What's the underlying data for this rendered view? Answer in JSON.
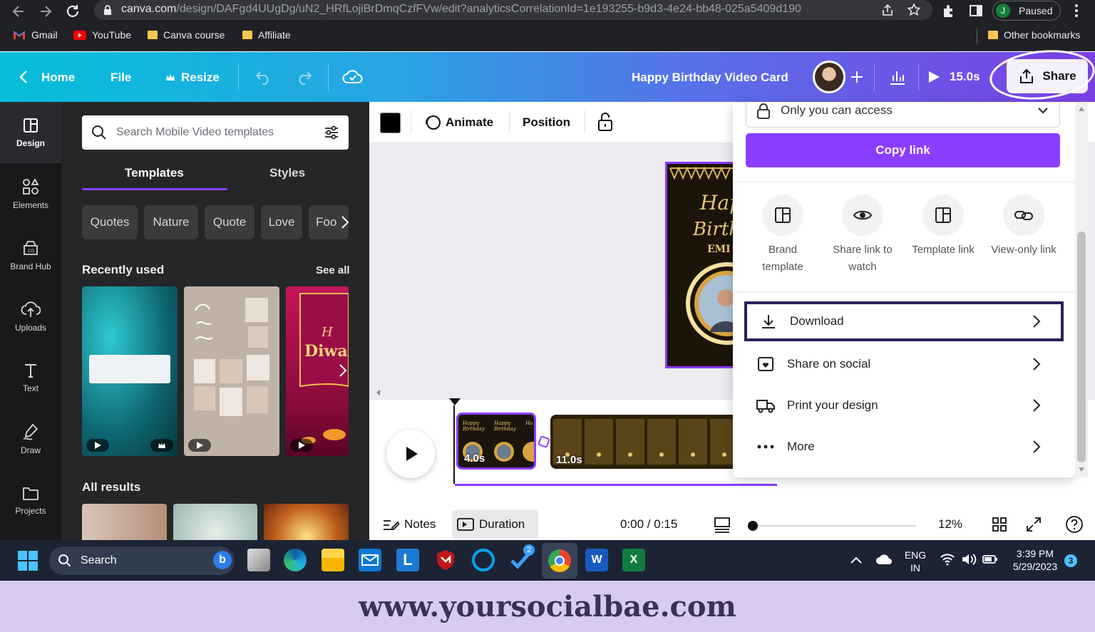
{
  "browser": {
    "url_host": "canva.com",
    "url_path": "/design/DAFgd4UUgDg/uN2_HRfLojiBrDmqCzfFVw/edit?analyticsCorrelationId=1e193255-b9d3-4e24-bb48-025a5409d190",
    "profile_initial": "J",
    "profile_status": "Paused",
    "bookmarks": [
      "Gmail",
      "YouTube",
      "Canva course",
      "Affiliate"
    ],
    "other_bookmarks": "Other bookmarks"
  },
  "header": {
    "home": "Home",
    "file": "File",
    "resize": "Resize",
    "title": "Happy Birthday Video Card",
    "duration": "15.0s",
    "share": "Share"
  },
  "rail": [
    "Design",
    "Elements",
    "Brand Hub",
    "Uploads",
    "Text",
    "Draw",
    "Projects"
  ],
  "panel": {
    "search_placeholder": "Search Mobile Video templates",
    "tabs": [
      "Templates",
      "Styles"
    ],
    "chips": [
      "Quotes",
      "Nature",
      "Quote",
      "Love",
      "Foo"
    ],
    "recent_title": "Recently used",
    "see_all": "See all",
    "all_results": "All results"
  },
  "toolbar": {
    "animate": "Animate",
    "position": "Position"
  },
  "timeline": {
    "clip1": "4.0s",
    "clip2": "11.0s",
    "notes": "Notes",
    "duration": "Duration",
    "time": "0:00 / 0:15",
    "zoom": "12%"
  },
  "share_menu": {
    "access": "Only you can access",
    "copy_link": "Copy link",
    "options": [
      {
        "line1": "Brand",
        "line2": "template"
      },
      {
        "line1": "Share link to",
        "line2": "watch"
      },
      {
        "line1": "Template link",
        "line2": ""
      },
      {
        "line1": "View-only link",
        "line2": ""
      }
    ],
    "rows": [
      "Download",
      "Share on social",
      "Print your design",
      "More"
    ]
  },
  "taskbar": {
    "search": "Search",
    "lang1": "ENG",
    "lang2": "IN",
    "time": "3:39 PM",
    "date": "5/29/2023",
    "notif_count": "3",
    "edge_badge": "2"
  },
  "footer": {
    "watermark": "www.yoursocialbae.com"
  },
  "colors": {
    "accent": "#8b3dff",
    "download_outline": "#2a1f5c",
    "footer_bg": "#d8c9f5"
  }
}
